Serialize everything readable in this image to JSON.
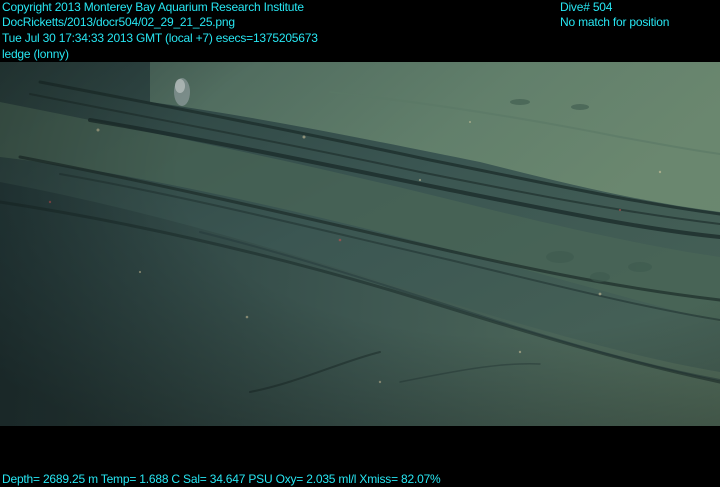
{
  "overlay": {
    "copyright": "Copyright 2013 Monterey Bay Aquarium Research Institute",
    "file_path": "DocRicketts/2013/docr504/02_29_21_25.png",
    "timestamp": "Tue Jul 30 17:34:33 2013 GMT (local +7)  esecs=1375205673",
    "label": "ledge (lonny)",
    "dive": "Dive# 504",
    "position_status": "No match for position",
    "telemetry": "Depth= 2689.25 m  Temp= 1.688 C  Sal= 34.647 PSU  Oxy= 2.035 ml/l  Xmiss= 82.07%"
  },
  "colors": {
    "overlay_text": "#27e6f2",
    "frame": "#000000",
    "water_dark": "#223a3a",
    "sediment": "#5c7b6a"
  }
}
